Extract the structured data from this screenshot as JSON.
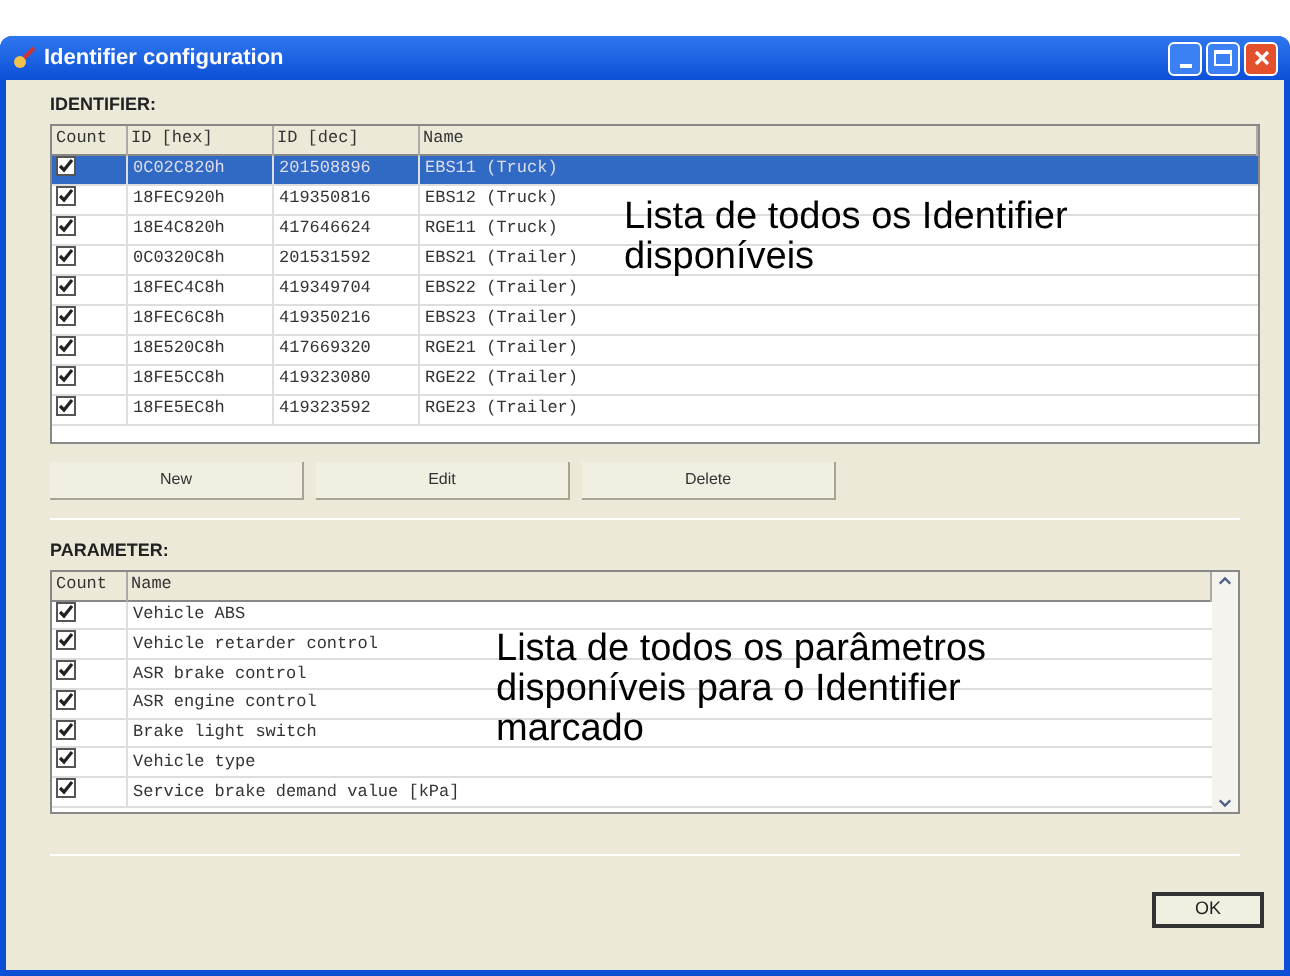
{
  "window": {
    "title": "Identifier configuration"
  },
  "identifier": {
    "label": "IDENTIFIER:",
    "columns": [
      "Count",
      "ID [hex]",
      "ID [dec]",
      "Name"
    ],
    "rows": [
      {
        "checked": true,
        "selected": true,
        "hex": "0C02C820h",
        "dec": "201508896",
        "name": "EBS11 (Truck)"
      },
      {
        "checked": true,
        "selected": false,
        "hex": "18FEC920h",
        "dec": "419350816",
        "name": "EBS12 (Truck)"
      },
      {
        "checked": true,
        "selected": false,
        "hex": "18E4C820h",
        "dec": "417646624",
        "name": "RGE11 (Truck)"
      },
      {
        "checked": true,
        "selected": false,
        "hex": "0C0320C8h",
        "dec": "201531592",
        "name": "EBS21 (Trailer)"
      },
      {
        "checked": true,
        "selected": false,
        "hex": "18FEC4C8h",
        "dec": "419349704",
        "name": "EBS22 (Trailer)"
      },
      {
        "checked": true,
        "selected": false,
        "hex": "18FEC6C8h",
        "dec": "419350216",
        "name": "EBS23 (Trailer)"
      },
      {
        "checked": true,
        "selected": false,
        "hex": "18E520C8h",
        "dec": "417669320",
        "name": "RGE21 (Trailer)"
      },
      {
        "checked": true,
        "selected": false,
        "hex": "18FE5CC8h",
        "dec": "419323080",
        "name": "RGE22 (Trailer)"
      },
      {
        "checked": true,
        "selected": false,
        "hex": "18FE5EC8h",
        "dec": "419323592",
        "name": "RGE23 (Trailer)"
      }
    ],
    "buttons": [
      "New",
      "Edit",
      "Delete"
    ]
  },
  "parameter": {
    "label": "PARAMETER:",
    "columns": [
      "Count",
      "Name"
    ],
    "rows": [
      {
        "checked": true,
        "name": "Vehicle ABS"
      },
      {
        "checked": true,
        "name": "Vehicle retarder control"
      },
      {
        "checked": true,
        "name": "ASR brake control"
      },
      {
        "checked": true,
        "name": "ASR engine control"
      },
      {
        "checked": true,
        "name": "Brake light switch"
      },
      {
        "checked": true,
        "name": "Vehicle type"
      },
      {
        "checked": true,
        "name": "Service brake demand value [kPa]"
      }
    ]
  },
  "annotations": [
    {
      "lines": [
        "Lista de todos os Identifier",
        "disponíveis"
      ]
    },
    {
      "lines": [
        "Lista de todos os parâmetros",
        "disponíveis para o Identifier",
        "marcado"
      ]
    }
  ],
  "ok_button": "OK"
}
